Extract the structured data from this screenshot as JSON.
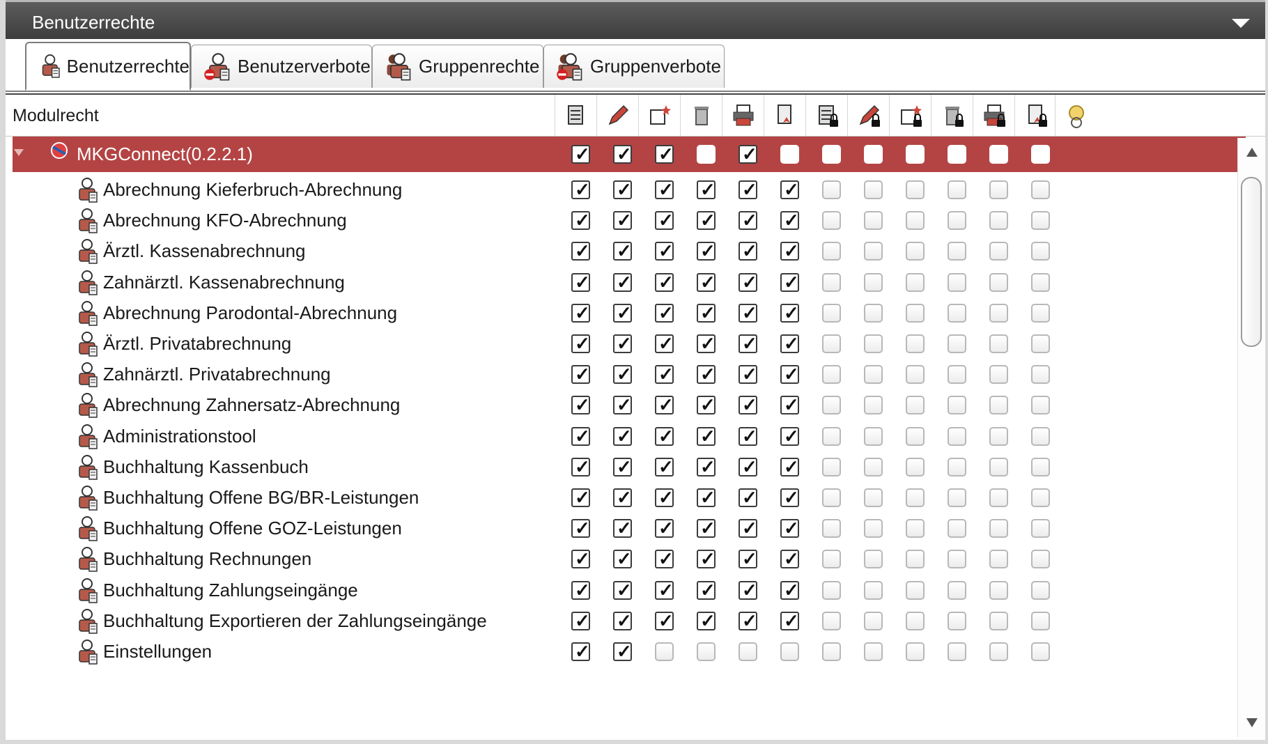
{
  "panel": {
    "title": "Benutzerrechte"
  },
  "tabs": [
    {
      "label": "Benutzerrechte",
      "icon": "user-rights-icon",
      "active": true
    },
    {
      "label": "Benutzerverbote",
      "icon": "user-prohibitions-icon",
      "active": false
    },
    {
      "label": "Gruppenrechte",
      "icon": "group-rights-icon",
      "active": false
    },
    {
      "label": "Gruppenverbote",
      "icon": "group-prohibitions-icon",
      "active": false
    }
  ],
  "grid": {
    "column_label": "Modulrecht",
    "permission_columns": [
      "list-icon",
      "edit-icon",
      "new-icon",
      "delete-icon",
      "print-icon",
      "export-icon",
      "list-locked-icon",
      "edit-locked-icon",
      "new-locked-icon",
      "delete-locked-icon",
      "print-locked-icon",
      "export-locked-icon",
      "special-icon"
    ],
    "root": {
      "label": "MKGConnect(0.2.2.1)",
      "checks": [
        true,
        true,
        true,
        false,
        true,
        false,
        false,
        false,
        false,
        false,
        false,
        false
      ]
    },
    "rows": [
      {
        "label": "Abrechnung Kieferbruch-Abrechnung",
        "checks": [
          true,
          true,
          true,
          true,
          true,
          true,
          false,
          false,
          false,
          false,
          false,
          false
        ]
      },
      {
        "label": "Abrechnung KFO-Abrechnung",
        "checks": [
          true,
          true,
          true,
          true,
          true,
          true,
          false,
          false,
          false,
          false,
          false,
          false
        ]
      },
      {
        "label": "Ärztl. Kassenabrechnung",
        "checks": [
          true,
          true,
          true,
          true,
          true,
          true,
          false,
          false,
          false,
          false,
          false,
          false
        ]
      },
      {
        "label": "Zahnärztl. Kassenabrechnung",
        "checks": [
          true,
          true,
          true,
          true,
          true,
          true,
          false,
          false,
          false,
          false,
          false,
          false
        ]
      },
      {
        "label": "Abrechnung Parodontal-Abrechnung",
        "checks": [
          true,
          true,
          true,
          true,
          true,
          true,
          false,
          false,
          false,
          false,
          false,
          false
        ]
      },
      {
        "label": "Ärztl. Privatabrechnung",
        "checks": [
          true,
          true,
          true,
          true,
          true,
          true,
          false,
          false,
          false,
          false,
          false,
          false
        ]
      },
      {
        "label": "Zahnärztl. Privatabrechnung",
        "checks": [
          true,
          true,
          true,
          true,
          true,
          true,
          false,
          false,
          false,
          false,
          false,
          false
        ]
      },
      {
        "label": "Abrechnung Zahnersatz-Abrechnung",
        "checks": [
          true,
          true,
          true,
          true,
          true,
          true,
          false,
          false,
          false,
          false,
          false,
          false
        ]
      },
      {
        "label": "Administrationstool",
        "checks": [
          true,
          true,
          true,
          true,
          true,
          true,
          false,
          false,
          false,
          false,
          false,
          false
        ]
      },
      {
        "label": "Buchhaltung Kassenbuch",
        "checks": [
          true,
          true,
          true,
          true,
          true,
          true,
          false,
          false,
          false,
          false,
          false,
          false
        ]
      },
      {
        "label": "Buchhaltung Offene BG/BR-Leistungen",
        "checks": [
          true,
          true,
          true,
          true,
          true,
          true,
          false,
          false,
          false,
          false,
          false,
          false
        ]
      },
      {
        "label": "Buchhaltung Offene GOZ-Leistungen",
        "checks": [
          true,
          true,
          true,
          true,
          true,
          true,
          false,
          false,
          false,
          false,
          false,
          false
        ]
      },
      {
        "label": "Buchhaltung Rechnungen",
        "checks": [
          true,
          true,
          true,
          true,
          true,
          true,
          false,
          false,
          false,
          false,
          false,
          false
        ]
      },
      {
        "label": "Buchhaltung Zahlungseingänge",
        "checks": [
          true,
          true,
          true,
          true,
          true,
          true,
          false,
          false,
          false,
          false,
          false,
          false
        ]
      },
      {
        "label": "Buchhaltung Exportieren der Zahlungseingänge",
        "checks": [
          true,
          true,
          true,
          true,
          true,
          true,
          false,
          false,
          false,
          false,
          false,
          false
        ]
      },
      {
        "label": "Einstellungen",
        "checks": [
          true,
          true,
          false,
          false,
          false,
          false,
          false,
          false,
          false,
          false,
          false,
          false
        ]
      }
    ]
  },
  "colors": {
    "header_bg": "#4a4a4a",
    "selected_row": "#b44444"
  }
}
